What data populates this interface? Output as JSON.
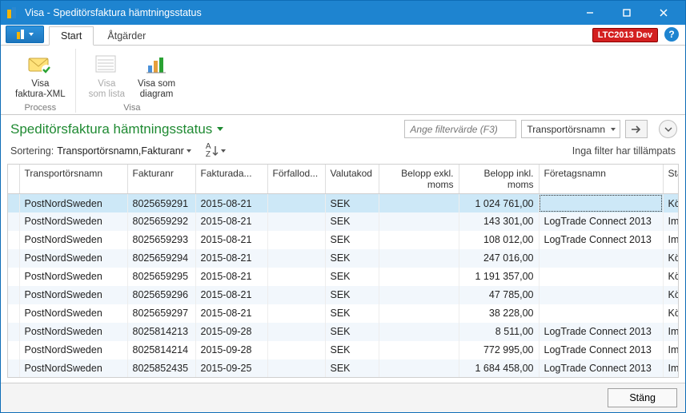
{
  "window": {
    "title": "Visa - Speditörsfaktura hämtningsstatus"
  },
  "badge": "LTC2013 Dev",
  "tabs": {
    "start": "Start",
    "actions": "Åtgärder"
  },
  "ribbon": {
    "process_group": "Process",
    "view_group": "Visa",
    "btn_xml": "Visa\nfaktura-XML",
    "btn_list": "Visa\nsom lista",
    "btn_chart": "Visa som\ndiagram"
  },
  "page": {
    "title": "Speditörsfaktura hämtningsstatus",
    "filter_placeholder": "Ange filtervärde (F3)",
    "filter_field": "Transportörsnamn",
    "sort_label": "Sortering:",
    "sort_field": "Transportörsnamn,Fakturanr",
    "no_filters": "Inga filter har tillämpats"
  },
  "columns": {
    "transporter": "Transportörsnamn",
    "invoice_no": "Fakturanr",
    "invoice_date": "Fakturada...",
    "due_date": "Förfallod...",
    "currency": "Valutakod",
    "amount_excl": "Belopp exkl. moms",
    "amount_incl": "Belopp inkl. moms",
    "company": "Företagsnamn",
    "status": "Status"
  },
  "rows": [
    {
      "transporter": "PostNordSweden",
      "invoice_no": "8025659291",
      "invoice_date": "2015-08-21",
      "due_date": "",
      "currency": "SEK",
      "amount_excl": "",
      "amount_incl": "1 024 761,00",
      "company": "",
      "status": "Köad",
      "selected": true
    },
    {
      "transporter": "PostNordSweden",
      "invoice_no": "8025659292",
      "invoice_date": "2015-08-21",
      "due_date": "",
      "currency": "SEK",
      "amount_excl": "",
      "amount_incl": "143 301,00",
      "company": "LogTrade Connect 2013",
      "status": "Importerad"
    },
    {
      "transporter": "PostNordSweden",
      "invoice_no": "8025659293",
      "invoice_date": "2015-08-21",
      "due_date": "",
      "currency": "SEK",
      "amount_excl": "",
      "amount_incl": "108 012,00",
      "company": "LogTrade Connect 2013",
      "status": "Importerad"
    },
    {
      "transporter": "PostNordSweden",
      "invoice_no": "8025659294",
      "invoice_date": "2015-08-21",
      "due_date": "",
      "currency": "SEK",
      "amount_excl": "",
      "amount_incl": "247 016,00",
      "company": "",
      "status": "Köad"
    },
    {
      "transporter": "PostNordSweden",
      "invoice_no": "8025659295",
      "invoice_date": "2015-08-21",
      "due_date": "",
      "currency": "SEK",
      "amount_excl": "",
      "amount_incl": "1 191 357,00",
      "company": "",
      "status": "Köad"
    },
    {
      "transporter": "PostNordSweden",
      "invoice_no": "8025659296",
      "invoice_date": "2015-08-21",
      "due_date": "",
      "currency": "SEK",
      "amount_excl": "",
      "amount_incl": "47 785,00",
      "company": "",
      "status": "Köad"
    },
    {
      "transporter": "PostNordSweden",
      "invoice_no": "8025659297",
      "invoice_date": "2015-08-21",
      "due_date": "",
      "currency": "SEK",
      "amount_excl": "",
      "amount_incl": "38 228,00",
      "company": "",
      "status": "Köad"
    },
    {
      "transporter": "PostNordSweden",
      "invoice_no": "8025814213",
      "invoice_date": "2015-09-28",
      "due_date": "",
      "currency": "SEK",
      "amount_excl": "",
      "amount_incl": "8 511,00",
      "company": "LogTrade Connect 2013",
      "status": "Importerad"
    },
    {
      "transporter": "PostNordSweden",
      "invoice_no": "8025814214",
      "invoice_date": "2015-09-28",
      "due_date": "",
      "currency": "SEK",
      "amount_excl": "",
      "amount_incl": "772 995,00",
      "company": "LogTrade Connect 2013",
      "status": "Importerad"
    },
    {
      "transporter": "PostNordSweden",
      "invoice_no": "8025852435",
      "invoice_date": "2015-09-25",
      "due_date": "",
      "currency": "SEK",
      "amount_excl": "",
      "amount_incl": "1 684 458,00",
      "company": "LogTrade Connect 2013",
      "status": "Importerad"
    }
  ],
  "footer": {
    "close": "Stäng"
  }
}
